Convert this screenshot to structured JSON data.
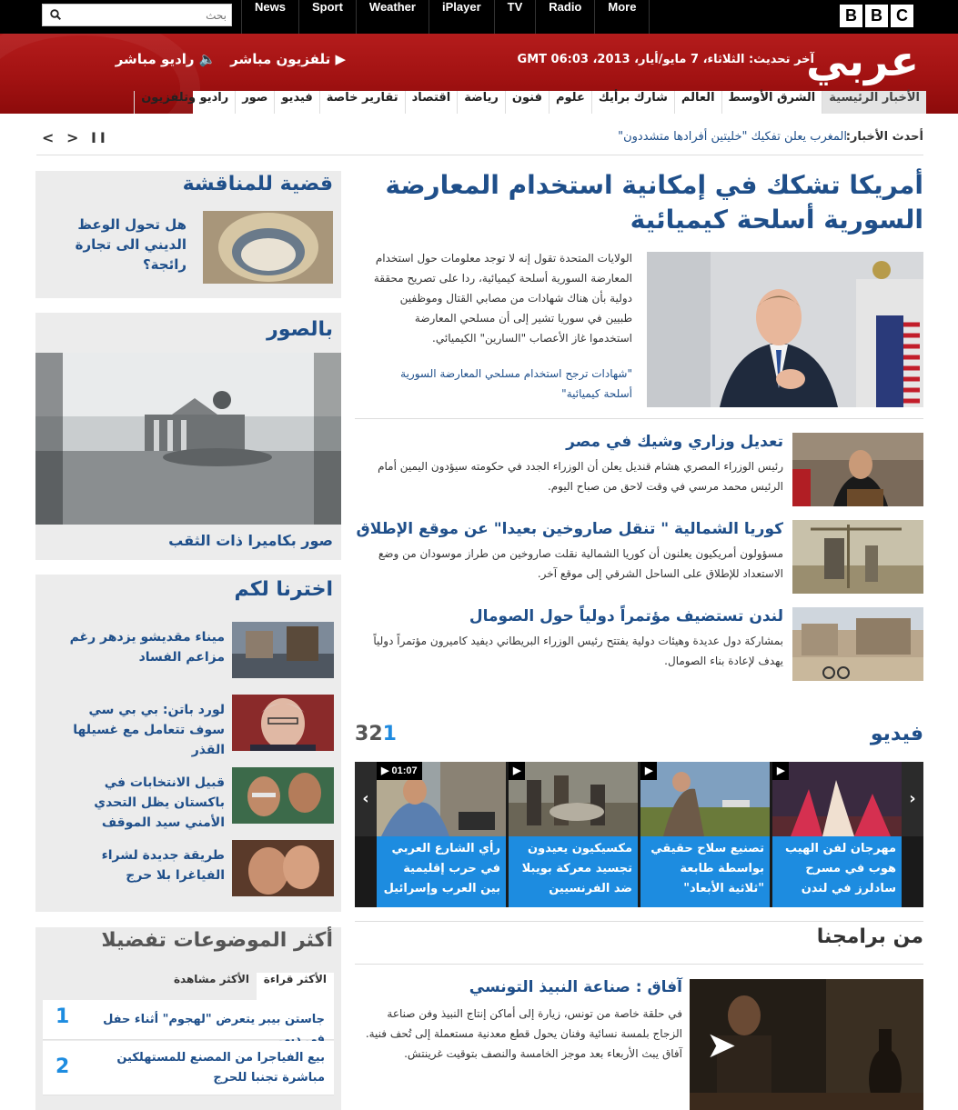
{
  "topnav": {
    "search_placeholder": "بحث",
    "links": [
      "News",
      "Sport",
      "Weather",
      "iPlayer",
      "TV",
      "Radio",
      "More"
    ],
    "logo_letters": [
      "B",
      "B",
      "C"
    ]
  },
  "header": {
    "logo": "عربي",
    "updated": "آخر تحديث: الثلاثاء، 7 مايو/أيار، 2013، GMT 06:03",
    "live_tv": "تلفزيون مباشر",
    "live_radio": "راديو مباشر",
    "nav": [
      "الأخبار الرئيسية",
      "الشرق الأوسط",
      "العالم",
      "شارك برأيك",
      "علوم",
      "فنون",
      "رياضة",
      "اقتصاد",
      "تقارير خاصة",
      "فيديو",
      "صور",
      "راديو وتلفزيون"
    ]
  },
  "ticker": {
    "label": "أحدث الأخبار:",
    "headline": "المغرب يعلن تفكيك \"خليتين أفرادها متشددون\"",
    "controls": "< > II"
  },
  "lead": {
    "headline": "أمريكا تشكك في إمكانية استخدام المعارضة السورية أسلحة كيميائية",
    "summary": "الولايات المتحدة تقول إنه لا توجد معلومات حول استخدام المعارضة السورية أسلحة كيميائية، ردا على تصريح محققة دولية بأن هناك شهادات من مصابي القتال وموظفين طبيين في سوريا تشير إلى أن مسلحي المعارضة استخدموا غاز الأعصاب \"السارين\" الكيميائي.",
    "related": "\"شهادات ترجح استخدام مسلحي المعارضة السورية أسلحة كيميائية\""
  },
  "stories": [
    {
      "title": "تعديل وزاري وشيك في مصر",
      "summary": "رئيس الوزراء المصري هشام قنديل يعلن أن الوزراء الجدد في حكومته سيؤدون اليمين أمام الرئيس محمد مرسي في وقت لاحق من صباح اليوم."
    },
    {
      "title": "كوريا الشمالية \" تنقل صاروخين بعيدا\" عن موقع الإطلاق",
      "summary": "مسؤولون أمريكيون يعلنون أن كوريا الشمالية نقلت صاروخين من طراز موسودان من وضع الاستعداد للإطلاق على الساحل الشرقي إلى موقع آخر."
    },
    {
      "title": "لندن تستضيف مؤتمراً دولياً حول الصومال",
      "summary": "بمشاركة دول عديدة وهيئات دولية يفتتح رئيس الوزراء البريطاني ديفيد كاميرون مؤتمراً دولياً يهدف لإعادة بناء الصومال."
    }
  ],
  "video": {
    "title": "فيديو",
    "pages": [
      "3",
      "2",
      "1"
    ],
    "duration": "01:07",
    "items": [
      "مهرجان لفن الهيب هوب في مسرح سادلرز في لندن",
      "تصنيع سلاح حقيقي بواسطة طابعة \"ثلاثية الأبعاد\"",
      "مكسيكيون يعيدون تجسيد معركة بويبلا ضد الفرنسيين",
      "رأي الشارع العربي في حرب إقليمية بين العرب وإسرائيل"
    ]
  },
  "programmes": {
    "title": "من برامجنا",
    "item_title": "آفاق : صناعة النبيذ التونسي",
    "item_text": "في حلقة خاصة من تونس، زيارة إلى أماكن إنتاج النبيذ وفن صناعة الزجاج بلمسة نسائية وفنان يحول قطع معدنية مستعملة إلى تُحف فنية. آفاق يبث الأربعاء بعد موجز الخامسة والنصف بتوقيت غرينتش."
  },
  "sidebar": {
    "debate": {
      "title": "قضية للمناقشة",
      "item": "هل تحول الوعظ الديني الى تجارة رائجة؟"
    },
    "photos": {
      "title": "بالصور",
      "caption": "صور بكاميرا ذات الثقب"
    },
    "picks": {
      "title": "اخترنا لكم",
      "items": [
        "ميناء مقديشو يزدهر رغم مزاعم الفساد",
        "لورد باتن: بي بي سي سوف تتعامل مع غسيلها القذر",
        "قبيل الانتخابات في باكستان يظل التحدي الأمني سيد الموقف",
        "طريقة جديدة لشراء الفياغرا بلا حرج"
      ]
    },
    "popular": {
      "title": "أكثر الموضوعات تفضيلا",
      "tabs": [
        "الأكثر قراءة",
        "الأكثر مشاهدة"
      ],
      "items": [
        {
          "rank": "1",
          "title": "جاستن بيبر يتعرض \"لهجوم\" أثناء حفل في دبي"
        },
        {
          "rank": "2",
          "title": "بيع الفياجرا من المصنع للمستهلكين مباشرة تجنبا للحرج"
        }
      ]
    }
  },
  "colors": {
    "bbc_red": "#a81515",
    "link_blue": "#1f4f8a",
    "video_blue": "#1d8ce0",
    "sidebar_gray": "#ececec"
  }
}
